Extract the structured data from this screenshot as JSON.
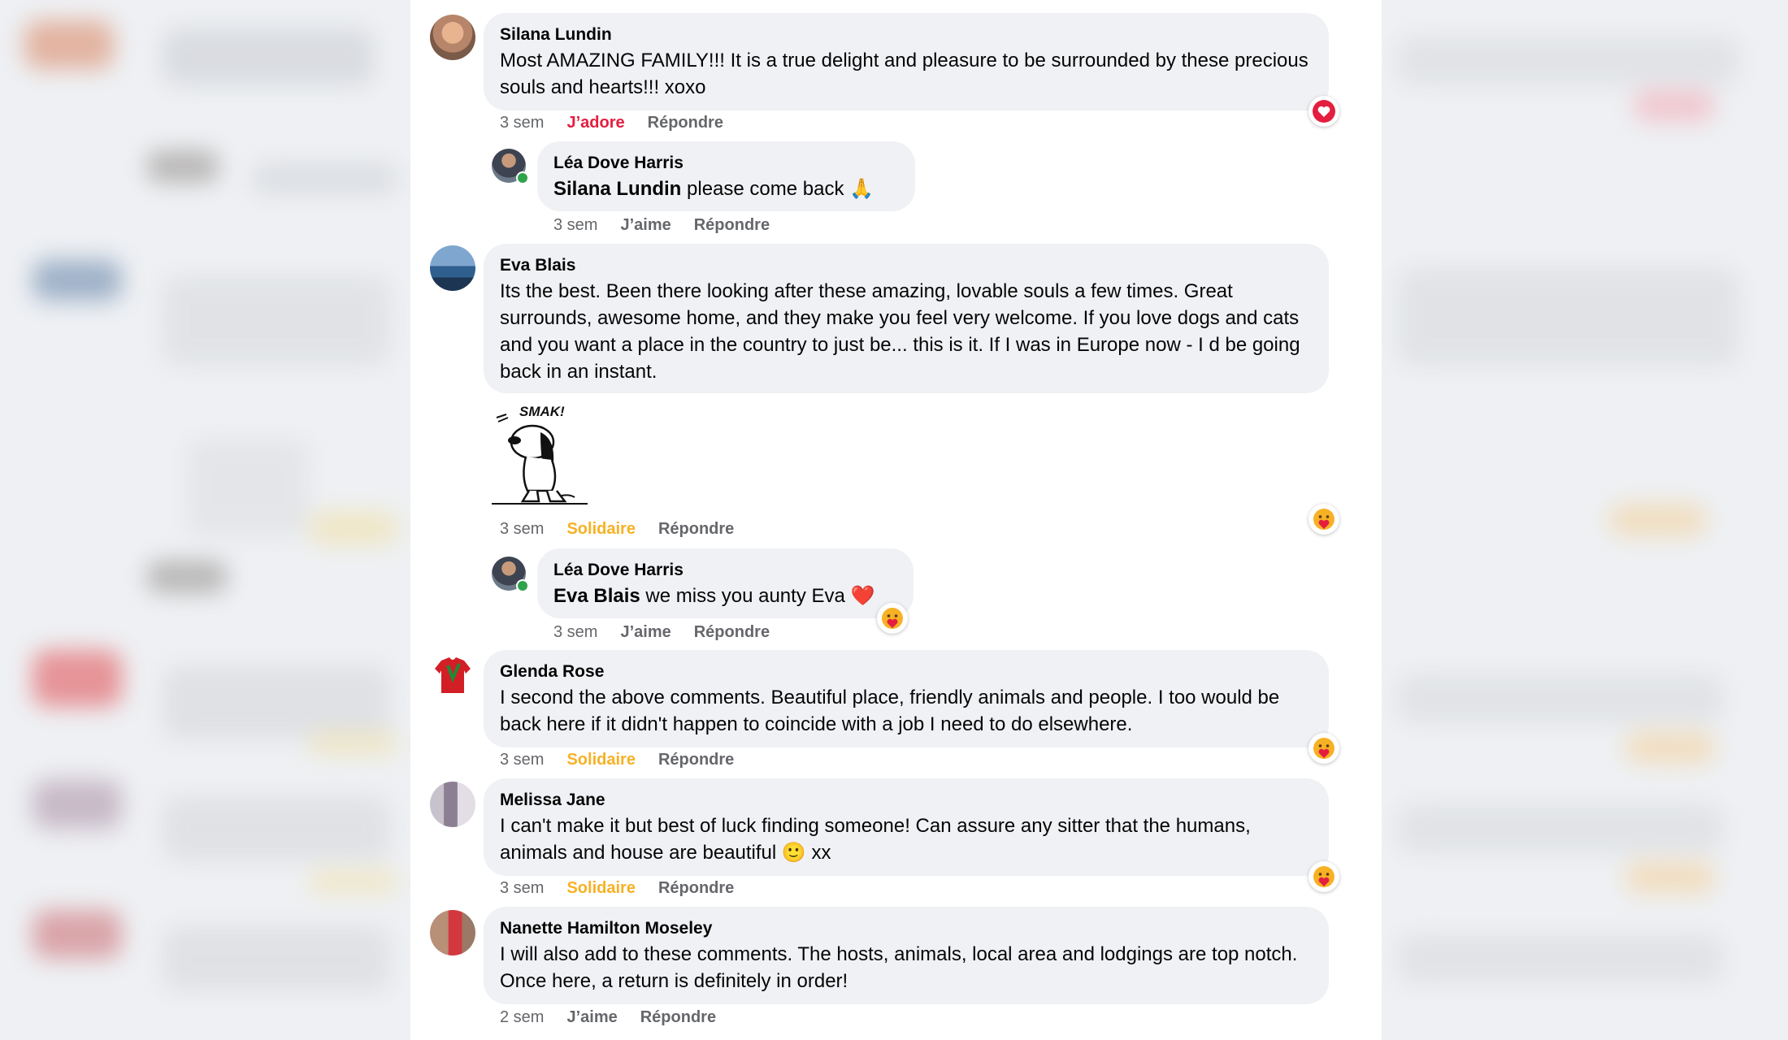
{
  "comments": [
    {
      "author": "Silana Lundin",
      "text": "Most AMAZING FAMILY!!! It is a true delight and pleasure to be surrounded by these precious souls and hearts!!! xoxo",
      "time": "3 sem",
      "reaction_label": "J’adore",
      "reply_label": "Répondre",
      "reaction_icon": "love-reaction-icon"
    },
    {
      "author": "Léa Dove Harris",
      "mention": "Silana Lundin",
      "text": " please come back 🙏",
      "time": "3 sem",
      "reaction_label": "J’aime",
      "reply_label": "Répondre"
    },
    {
      "author": "Eva Blais",
      "text": "Its the best. Been there looking after these amazing, lovable souls a few times. Great surrounds, awesome home, and they make you feel very welcome. If you love dogs and cats and you want a place in the country to just be... this is it. If I was in Europe now - I d be going back in an instant.",
      "sticker_text": "SMAK!",
      "time": "3 sem",
      "reaction_label": "Solidaire",
      "reply_label": "Répondre",
      "reaction_icon": "care-reaction-icon"
    },
    {
      "author": "Léa Dove Harris",
      "mention": "Eva Blais",
      "text": " we miss you aunty Eva ❤️",
      "time": "3 sem",
      "reaction_label": "J’aime",
      "reply_label": "Répondre",
      "reaction_icon": "care-reaction-icon"
    },
    {
      "author": "Glenda Rose",
      "text": "I second the above comments. Beautiful place, friendly animals and people. I too would be back here if it didn't happen to coincide with a job I need to do elsewhere.",
      "time": "3 sem",
      "reaction_label": "Solidaire",
      "reply_label": "Répondre",
      "reaction_icon": "care-reaction-icon"
    },
    {
      "author": "Melissa Jane",
      "text": "I can't make it but best of luck finding someone! Can assure any sitter that the humans, animals and house are beautiful 🙂 xx",
      "time": "3 sem",
      "reaction_label": "Solidaire",
      "reply_label": "Répondre",
      "reaction_icon": "care-reaction-icon"
    },
    {
      "author": "Nanette Hamilton Moseley",
      "text": "I will also add to these comments. The hosts, animals, local area and lodgings are top notch. Once here, a return is definitely in order!",
      "time": "2 sem",
      "reaction_label": "J’aime",
      "reply_label": "Répondre"
    }
  ],
  "colors": {
    "bubble": "#eff1f4",
    "love": "#e41e3f",
    "care": "#f7b125",
    "meta": "#65676b",
    "online": "#31a24c"
  }
}
